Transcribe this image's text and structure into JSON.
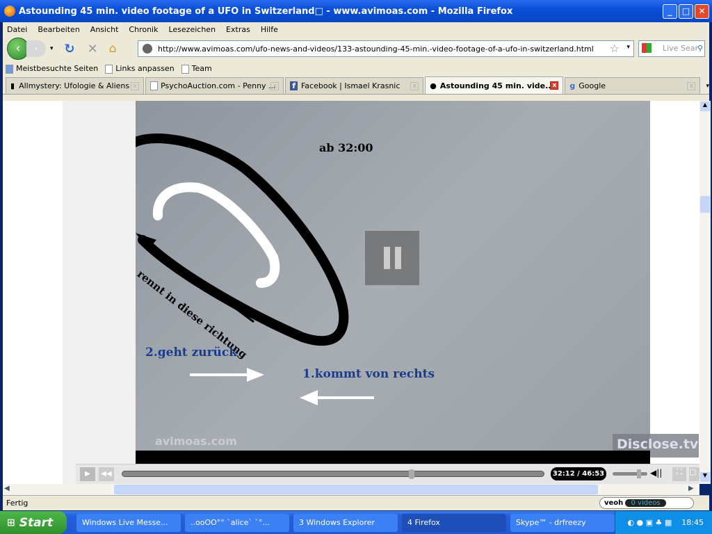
{
  "window": {
    "title": "Astounding 45 min. video footage of a UFO in Switzerland□ - www.avimoas.com - Mozilla Firefox"
  },
  "menu": [
    "Datei",
    "Bearbeiten",
    "Ansicht",
    "Chronik",
    "Lesezeichen",
    "Extras",
    "Hilfe"
  ],
  "url": "http://www.avimoas.com/ufo-news-and-videos/133-astounding-45-min.-video-footage-of-a-ufo-in-switzerland.html",
  "search_placeholder": "Live Sear",
  "bookmarks": [
    "Meistbesuchte Seiten",
    "Links anpassen",
    "Team"
  ],
  "tabs": [
    {
      "label": "Allmystery: Ufologie & Aliens"
    },
    {
      "label": "PsychoAuction.com - Penny ..."
    },
    {
      "label": "Facebook | Ismael Krasnic"
    },
    {
      "label": "Astounding 45 min. vide...",
      "active": true
    },
    {
      "label": "Google"
    }
  ],
  "video": {
    "annotation_time": "ab 32:00",
    "annotation_direction": "rennt in diese richtung",
    "annotation_back": "2.geht zurück",
    "annotation_right": "1.kommt von rechts",
    "watermark_left": "avimoas.com",
    "watermark_right": "Disclose.tv",
    "time": "32:12 / 46:53",
    "progress": 0.687,
    "volume": 0.8
  },
  "status": {
    "text": "Fertig",
    "veoh": "veoh",
    "videos": "0 videos"
  },
  "taskbar": {
    "start": "Start",
    "tasks": [
      "Windows Live Messe...",
      "..ooOO°° `alice` `°...",
      "3 Windows Explorer",
      "4 Firefox",
      "Skype™ - drfreezy"
    ],
    "clock": "18:45"
  }
}
